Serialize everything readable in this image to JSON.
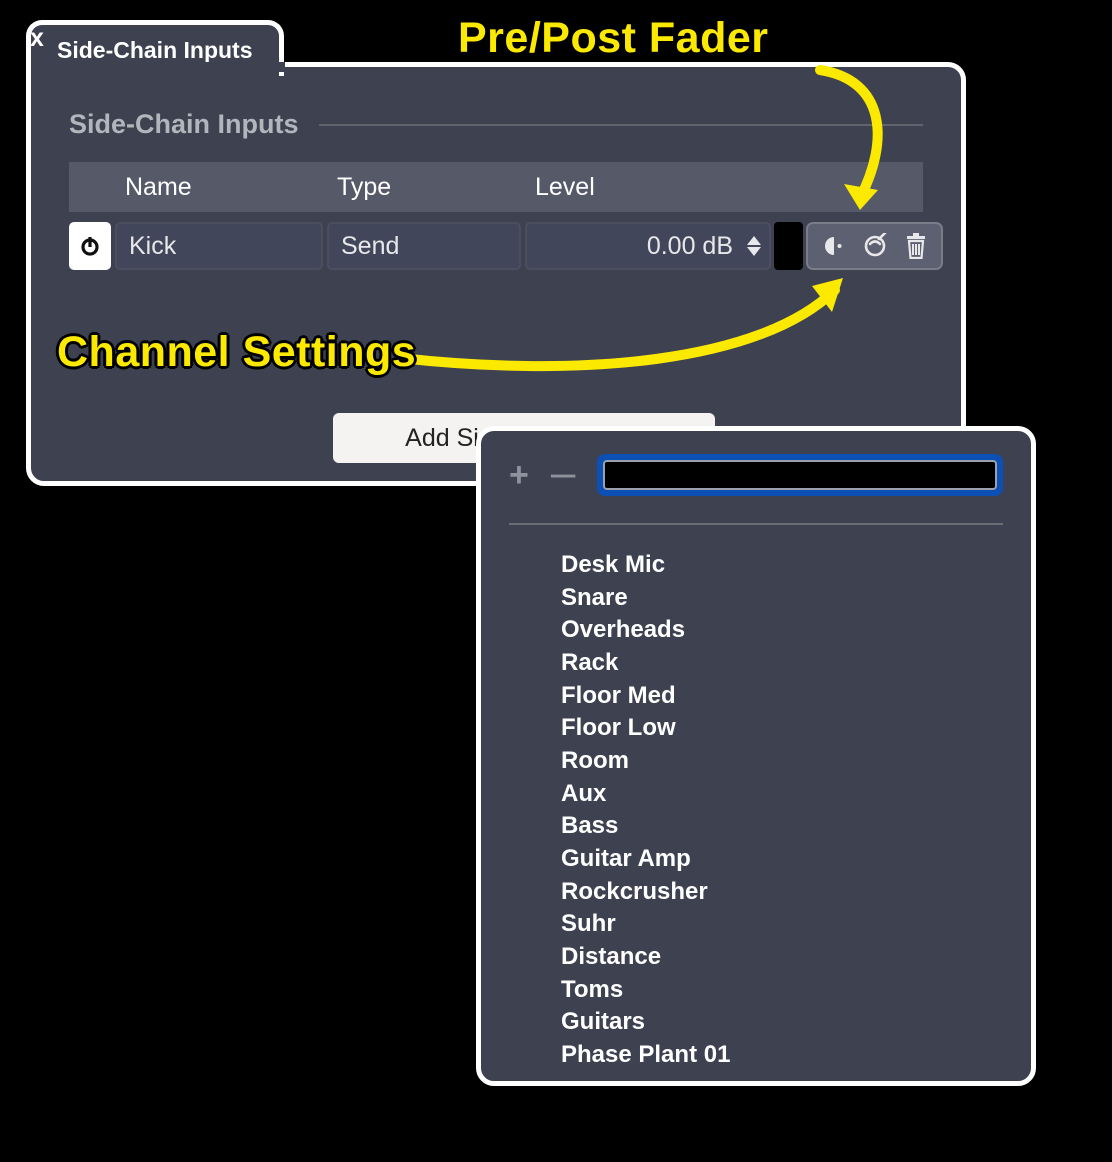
{
  "window": {
    "close_label": "x",
    "tab_title": "Side-Chain Inputs"
  },
  "section": {
    "title": "Side-Chain Inputs",
    "columns": {
      "name": "Name",
      "type": "Type",
      "level": "Level"
    }
  },
  "row": {
    "name": "Kick",
    "type": "Send",
    "level": "0.00 dB"
  },
  "add_button": "Add Side-Chain Input",
  "picker": {
    "search_value": "",
    "items": [
      "Desk Mic",
      "Snare",
      "Overheads",
      "Rack",
      "Floor Med",
      "Floor Low",
      "Room",
      "Aux",
      "Bass",
      "Guitar Amp",
      "Rockcrusher",
      "Suhr",
      "Distance",
      "Toms",
      "Guitars",
      "Phase Plant 01"
    ]
  },
  "annotations": {
    "pre_post": "Pre/Post Fader",
    "channel_settings": "Channel Settings"
  }
}
